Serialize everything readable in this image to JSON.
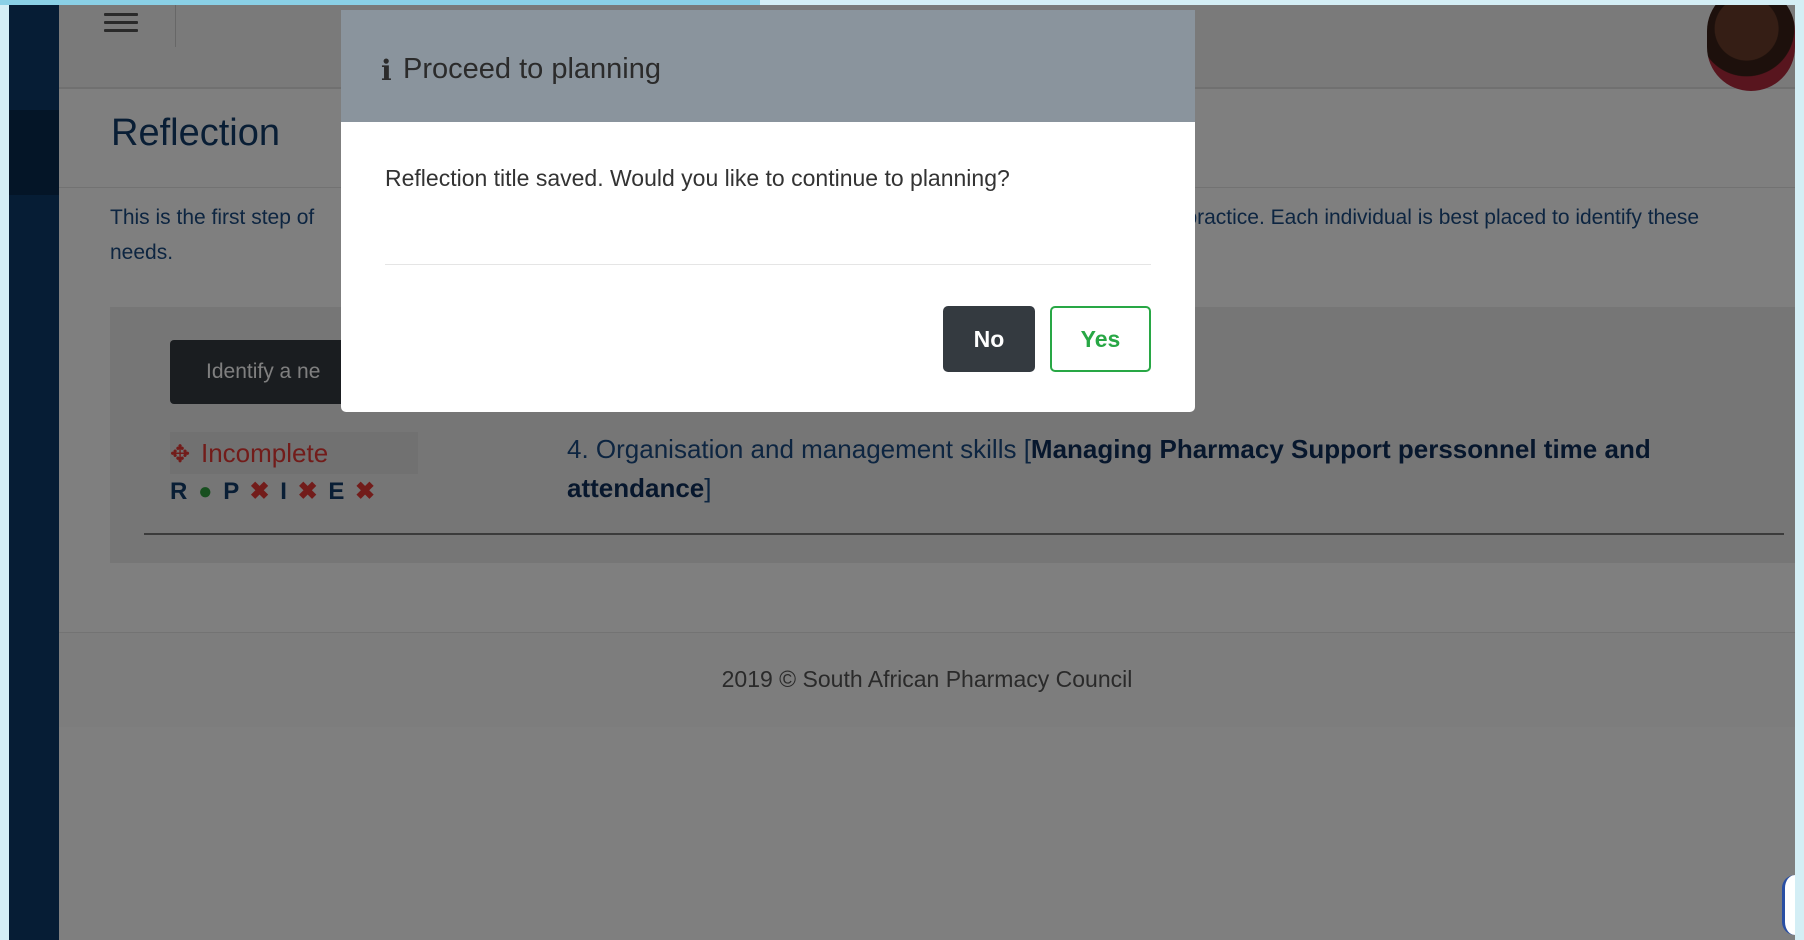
{
  "page": {
    "title": "Reflection",
    "intro_start": "This is the first step of",
    "intro_end": "on practice. Each individual is best placed to identify these",
    "intro_line2": "needs.",
    "identify_button_label": "Identify a ne",
    "status_label": "Incomplete",
    "status_icon": "crosshairs-icon",
    "rpie": {
      "r": "R",
      "p": "P",
      "i": "I",
      "e": "E"
    },
    "need_prefix": "4. Organisation and management skills [",
    "need_bold": "Managing Pharmacy Support perssonnel time and attendance",
    "need_suffix": "]",
    "footer_text": "2019 © South African Pharmacy Council"
  },
  "modal": {
    "title": "Proceed to planning",
    "icon": "info-icon",
    "message": "Reflection title saved. Would you like to continue to planning?",
    "no_label": "No",
    "yes_label": "Yes"
  },
  "colors": {
    "sidebar": "#0d3a6a",
    "incomplete": "#e53935",
    "complete": "#2e9e3e",
    "yes_accent": "#28a745",
    "dark_button": "#343a40",
    "modal_header": "#8a949d"
  }
}
